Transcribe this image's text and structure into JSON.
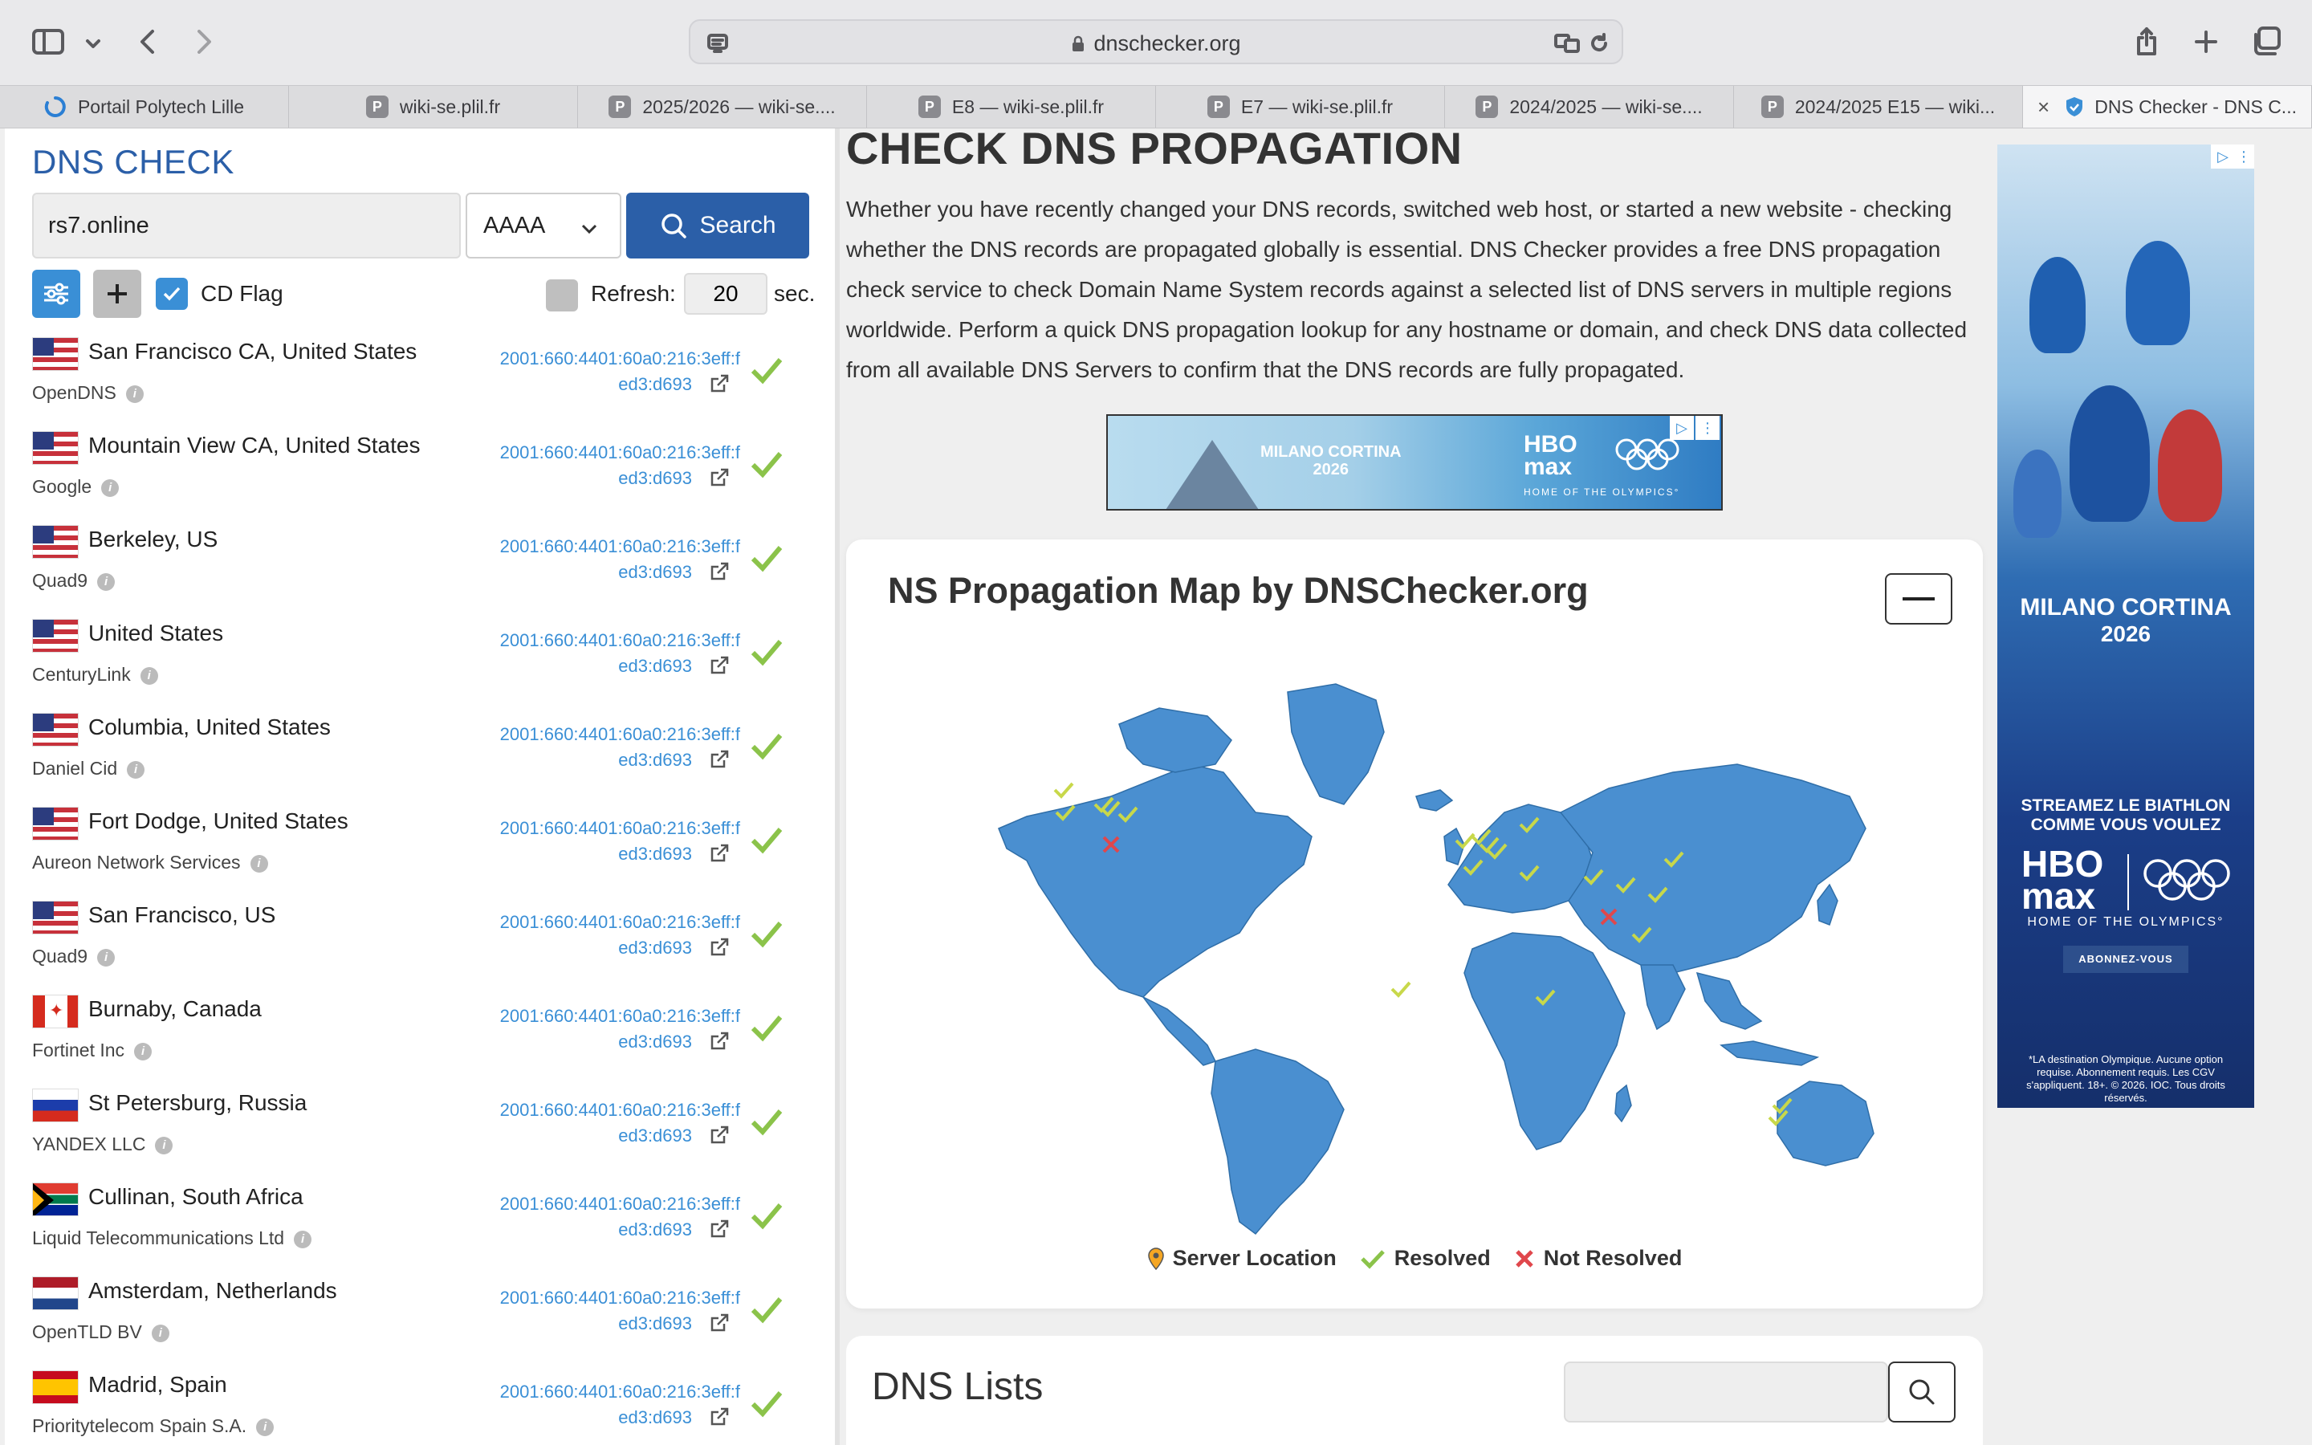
{
  "browser": {
    "url": "dnschecker.org",
    "tabs": [
      {
        "label": "Portail Polytech Lille",
        "favicon": "loading-spinner-icon"
      },
      {
        "label": "wiki-se.plil.fr",
        "favicon": "P"
      },
      {
        "label": "2025/2026 — wiki-se....",
        "favicon": "P"
      },
      {
        "label": "E8 — wiki-se.plil.fr",
        "favicon": "P"
      },
      {
        "label": "E7 — wiki-se.plil.fr",
        "favicon": "P"
      },
      {
        "label": "2024/2025 — wiki-se....",
        "favicon": "P"
      },
      {
        "label": "2024/2025 E15 — wiki...",
        "favicon": "P"
      },
      {
        "label": "DNS Checker - DNS C...",
        "favicon": "dns-checker-shield-icon",
        "active": true
      }
    ]
  },
  "checker": {
    "title": "DNS CHECK",
    "domain": "rs7.online",
    "record_type": "AAAA",
    "search_label": "Search",
    "cd_flag_label": "CD Flag",
    "cd_flag_checked": true,
    "refresh_label": "Refresh:",
    "refresh_value": "20",
    "sec_label": "sec.",
    "results": [
      {
        "flag": "us",
        "location": "San Francisco CA, United States",
        "provider": "OpenDNS",
        "ip_line1": "2001:660:4401:60a0:216:3eff:f",
        "ip_line2": "ed3:d693",
        "status": "resolved"
      },
      {
        "flag": "us",
        "location": "Mountain View CA, United States",
        "provider": "Google",
        "ip_line1": "2001:660:4401:60a0:216:3eff:f",
        "ip_line2": "ed3:d693",
        "status": "resolved"
      },
      {
        "flag": "us",
        "location": "Berkeley, US",
        "provider": "Quad9",
        "ip_line1": "2001:660:4401:60a0:216:3eff:f",
        "ip_line2": "ed3:d693",
        "status": "resolved"
      },
      {
        "flag": "us",
        "location": "United States",
        "provider": "CenturyLink",
        "ip_line1": "2001:660:4401:60a0:216:3eff:f",
        "ip_line2": "ed3:d693",
        "status": "resolved"
      },
      {
        "flag": "us",
        "location": "Columbia, United States",
        "provider": "Daniel Cid",
        "ip_line1": "2001:660:4401:60a0:216:3eff:f",
        "ip_line2": "ed3:d693",
        "status": "resolved"
      },
      {
        "flag": "us",
        "location": "Fort Dodge, United States",
        "provider": "Aureon Network Services",
        "ip_line1": "2001:660:4401:60a0:216:3eff:f",
        "ip_line2": "ed3:d693",
        "status": "resolved"
      },
      {
        "flag": "us",
        "location": "San Francisco, US",
        "provider": "Quad9",
        "ip_line1": "2001:660:4401:60a0:216:3eff:f",
        "ip_line2": "ed3:d693",
        "status": "resolved"
      },
      {
        "flag": "ca",
        "location": "Burnaby, Canada",
        "provider": "Fortinet Inc",
        "ip_line1": "2001:660:4401:60a0:216:3eff:f",
        "ip_line2": "ed3:d693",
        "status": "resolved"
      },
      {
        "flag": "ru",
        "location": "St Petersburg, Russia",
        "provider": "YANDEX LLC",
        "ip_line1": "2001:660:4401:60a0:216:3eff:f",
        "ip_line2": "ed3:d693",
        "status": "resolved"
      },
      {
        "flag": "za",
        "location": "Cullinan, South Africa",
        "provider": "Liquid Telecommunications Ltd",
        "ip_line1": "2001:660:4401:60a0:216:3eff:f",
        "ip_line2": "ed3:d693",
        "status": "resolved"
      },
      {
        "flag": "nl",
        "location": "Amsterdam, Netherlands",
        "provider": "OpenTLD BV",
        "ip_line1": "2001:660:4401:60a0:216:3eff:f",
        "ip_line2": "ed3:d693",
        "status": "resolved"
      },
      {
        "flag": "es",
        "location": "Madrid, Spain",
        "provider": "Prioritytelecom Spain S.A.",
        "ip_line1": "2001:660:4401:60a0:216:3eff:f",
        "ip_line2": "ed3:d693",
        "status": "resolved"
      }
    ]
  },
  "main": {
    "heading": "CHECK DNS PROPAGATION",
    "intro": "Whether you have recently changed your DNS records, switched web host, or started a new website - checking whether the DNS records are propagated globally is essential. DNS Checker provides a free DNS propagation check service to check Domain Name System records against a selected list of DNS servers in multiple regions worldwide. Perform a quick DNS propagation lookup for any hostname or domain, and check DNS data collected from all available DNS Servers to confirm that the DNS records are fully propagated.",
    "map_title": "NS Propagation Map by DNSChecker.org",
    "legend": {
      "server_location": "Server Location",
      "resolved": "Resolved",
      "not_resolved": "Not Resolved"
    },
    "dns_lists_title": "DNS Lists"
  },
  "ads": {
    "banner": {
      "brand": "MILANO CORTINA",
      "year": "2026",
      "hbo_line1": "HBO",
      "hbo_line2": "max",
      "tagline": "HOME OF THE OLYMPICS°"
    },
    "side": {
      "brand": "MILANO CORTINA",
      "year": "2026",
      "headline1": "STREAMEZ LE BIATHLON",
      "headline2": "COMME VOUS VOULEZ",
      "hbo_line1": "HBO",
      "hbo_line2": "max",
      "tagline": "HOME OF THE OLYMPICS°",
      "cta": "ABONNEZ-VOUS",
      "legal": "*LA destination Olympique. Aucune option requise. Abonnement requis. Les CGV s'appliquent. 18+. © 2026. IOC. Tous droits réservés."
    }
  },
  "colors": {
    "brand_blue": "#2b5fa8",
    "link_blue": "#3a8fd6",
    "map_land": "#4a8fd0",
    "resolved_green": "#8bc34a",
    "not_resolved_red": "#e0474c"
  }
}
